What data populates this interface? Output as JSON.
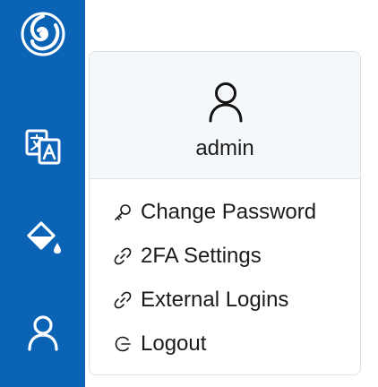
{
  "sidebar": {
    "items": [
      {
        "name": "app-logo",
        "icon": "spiral-logo-icon"
      },
      {
        "name": "language",
        "icon": "translate-icon"
      },
      {
        "name": "theme",
        "icon": "paint-bucket-icon"
      },
      {
        "name": "user",
        "icon": "user-icon"
      }
    ],
    "background": "#0b63b6"
  },
  "user_menu": {
    "username": "admin",
    "items": [
      {
        "label": "Change Password",
        "icon": "key-icon"
      },
      {
        "label": "2FA Settings",
        "icon": "link-icon"
      },
      {
        "label": "External Logins",
        "icon": "link-icon"
      },
      {
        "label": "Logout",
        "icon": "logout-icon"
      }
    ]
  }
}
